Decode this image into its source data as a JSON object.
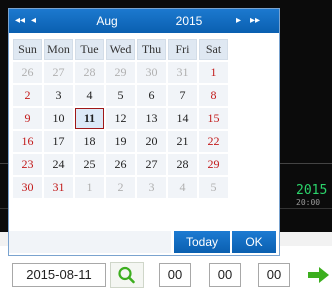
{
  "header": {
    "prev_year": "◂◂",
    "prev_month": "◂",
    "month": "Aug",
    "year": "2015",
    "next_month": "▸",
    "next_year": "▸▸"
  },
  "weekdays": [
    "Sun",
    "Mon",
    "Tue",
    "Wed",
    "Thu",
    "Fri",
    "Sat"
  ],
  "weeks": [
    [
      "26",
      "27",
      "28",
      "29",
      "30",
      "31",
      "1"
    ],
    [
      "2",
      "3",
      "4",
      "5",
      "6",
      "7",
      "8"
    ],
    [
      "9",
      "10",
      "11",
      "12",
      "13",
      "14",
      "15"
    ],
    [
      "16",
      "17",
      "18",
      "19",
      "20",
      "21",
      "22"
    ],
    [
      "23",
      "24",
      "25",
      "26",
      "27",
      "28",
      "29"
    ],
    [
      "30",
      "31",
      "1",
      "2",
      "3",
      "4",
      "5"
    ]
  ],
  "selected_day": "11",
  "buttons": {
    "today": "Today",
    "ok": "OK"
  },
  "search": {
    "date": "2015-08-11",
    "hour": "00",
    "minute": "00",
    "second": "00"
  },
  "background": {
    "timestamp_date": "2015",
    "timestamp_time": "20:00"
  },
  "icons": {
    "search": "magnifier-icon",
    "go": "arrow-right-icon"
  },
  "colors": {
    "header_blue": "#0a5fb0",
    "weekend_red": "#c21a1a",
    "selected_border": "#a01818",
    "go_green": "#3cae1e"
  }
}
